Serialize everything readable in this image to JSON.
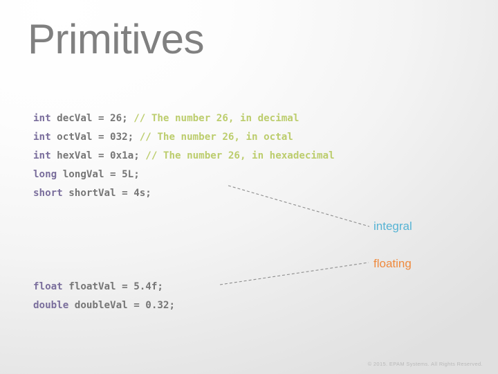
{
  "slide": {
    "title": "Primitives",
    "footer": "© 2015. EPAM Systems. All Rights Reserved."
  },
  "colors": {
    "title": "#808080",
    "keyword": "#7a6e9c",
    "identifier": "#767676",
    "comment": "#bccd6d",
    "integral_label": "#56b3d4",
    "floating_label": "#ef8a3e",
    "connector": "#8c8c8c",
    "footer": "#b9b9b9",
    "background_start": "#ffffff",
    "background_end": "#e0e0e0"
  },
  "code": {
    "lines": [
      {
        "keyword": "int",
        "body": " decVal = 26; ",
        "comment": "// The number 26, in decimal"
      },
      {
        "keyword": "int",
        "body": " octVal = 032; ",
        "comment": "// The number 26, in octal"
      },
      {
        "keyword": "int",
        "body": " hexVal = 0x1a; ",
        "comment": "// The number 26, in hexadecimal"
      },
      {
        "keyword": "long",
        "body": " longVal = 5L;",
        "comment": ""
      },
      {
        "keyword": "short",
        "body": " shortVal = 4s;",
        "comment": ""
      },
      {
        "keyword": "float",
        "body": " floatVal = 5.4f;",
        "comment": ""
      },
      {
        "keyword": "double",
        "body": " doubleVal = 0.32;",
        "comment": ""
      }
    ]
  },
  "annotations": {
    "integral": "integral",
    "floating": "floating"
  }
}
